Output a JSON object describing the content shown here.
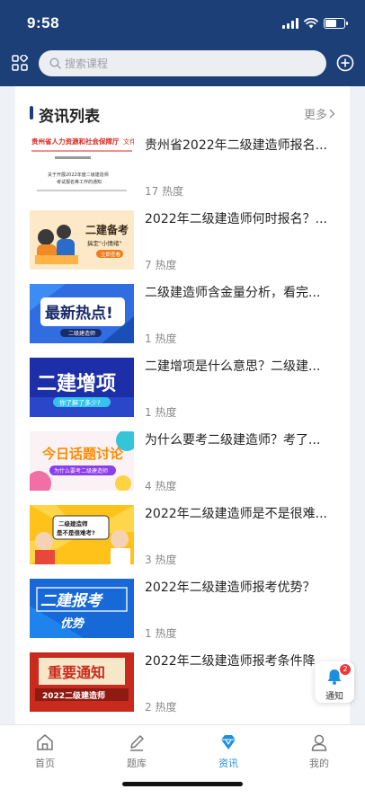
{
  "status": {
    "time": "9:58"
  },
  "search": {
    "placeholder": "搜索课程"
  },
  "section": {
    "title": "资讯列表",
    "more": "更多"
  },
  "news": [
    {
      "title": "贵州省2022年二级建造师报名...",
      "heat": "17 热度"
    },
    {
      "title": "2022年二级建造师何时报名？...",
      "heat": "7 热度"
    },
    {
      "title": "二级建造师含金量分析，看完...",
      "heat": "1 热度"
    },
    {
      "title": "二建增项是什么意思？二级建...",
      "heat": "1 热度"
    },
    {
      "title": "为什么要考二级建造师？考了...",
      "heat": "4 热度"
    },
    {
      "title": "2022年二级建造师是不是很难...",
      "heat": "3 热度"
    },
    {
      "title": "2022年二级建造师报考优势？",
      "heat": "1 热度"
    },
    {
      "title": "2022年二级建造师报考条件降",
      "heat": "2 热度"
    }
  ],
  "thumbs": {
    "t1": {
      "header": "贵州省人力资源和社会保障厅",
      "side": "文件",
      "subject": "关于开展2022年度二级建造师",
      "subject2": "考试报名等工作的通知"
    },
    "t2": {
      "main": "二建备考",
      "sub": "搞定\"小情绪\"",
      "btn": "立即查看"
    },
    "t3": {
      "main": "最新热点!",
      "tag": "二级建造师"
    },
    "t4": {
      "main": "二建增项",
      "sub": "你了解了多少?"
    },
    "t5": {
      "main": "今日话题讨论",
      "sub": "为什么要考二级建造师"
    },
    "t6": {
      "line1": "二级建造师",
      "line2": "是不是很难考?"
    },
    "t7": {
      "main": "二建报考",
      "sub": "优势"
    },
    "t8": {
      "main": "重要通知",
      "sub": "2022二级建造师"
    }
  },
  "notify": {
    "label": "通知",
    "count": "2"
  },
  "tabs": [
    {
      "label": "首页",
      "icon": "home-icon"
    },
    {
      "label": "题库",
      "icon": "pencil-icon"
    },
    {
      "label": "资讯",
      "icon": "diamond-icon"
    },
    {
      "label": "我的",
      "icon": "user-icon"
    }
  ],
  "colors": {
    "navy": "#1c3f77",
    "active": "#1d8fe0",
    "badge": "#e8383a"
  }
}
